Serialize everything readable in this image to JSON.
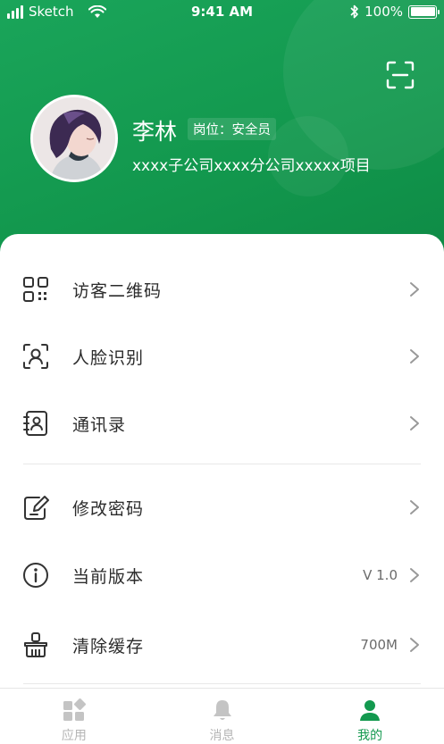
{
  "status_bar": {
    "carrier": "Sketch",
    "time": "9:41 AM",
    "battery": "100%",
    "battery_level": 1.0
  },
  "profile": {
    "name": "李林",
    "role": "岗位：安全员",
    "organization": "xxxx子公司xxxx分公司xxxxx项目"
  },
  "menu": [
    {
      "label": "访客二维码",
      "icon": "qr-code-icon",
      "value": ""
    },
    {
      "label": "人脸识别",
      "icon": "face-scan-icon",
      "value": ""
    },
    {
      "label": "通讯录",
      "icon": "contacts-book-icon",
      "value": ""
    },
    {
      "label": "修改密码",
      "icon": "edit-password-icon",
      "value": ""
    },
    {
      "label": "当前版本",
      "icon": "info-icon",
      "value": "V 1.0"
    },
    {
      "label": "清除缓存",
      "icon": "clean-brush-icon",
      "value": "700M"
    }
  ],
  "tabbar": [
    {
      "label": "应用",
      "icon": "apps-icon",
      "active": false
    },
    {
      "label": "消息",
      "icon": "bell-icon",
      "active": false
    },
    {
      "label": "我的",
      "icon": "user-icon",
      "active": true
    }
  ],
  "colors": {
    "brand_green": "#13994f",
    "inactive_gray": "#b5b5b5"
  }
}
